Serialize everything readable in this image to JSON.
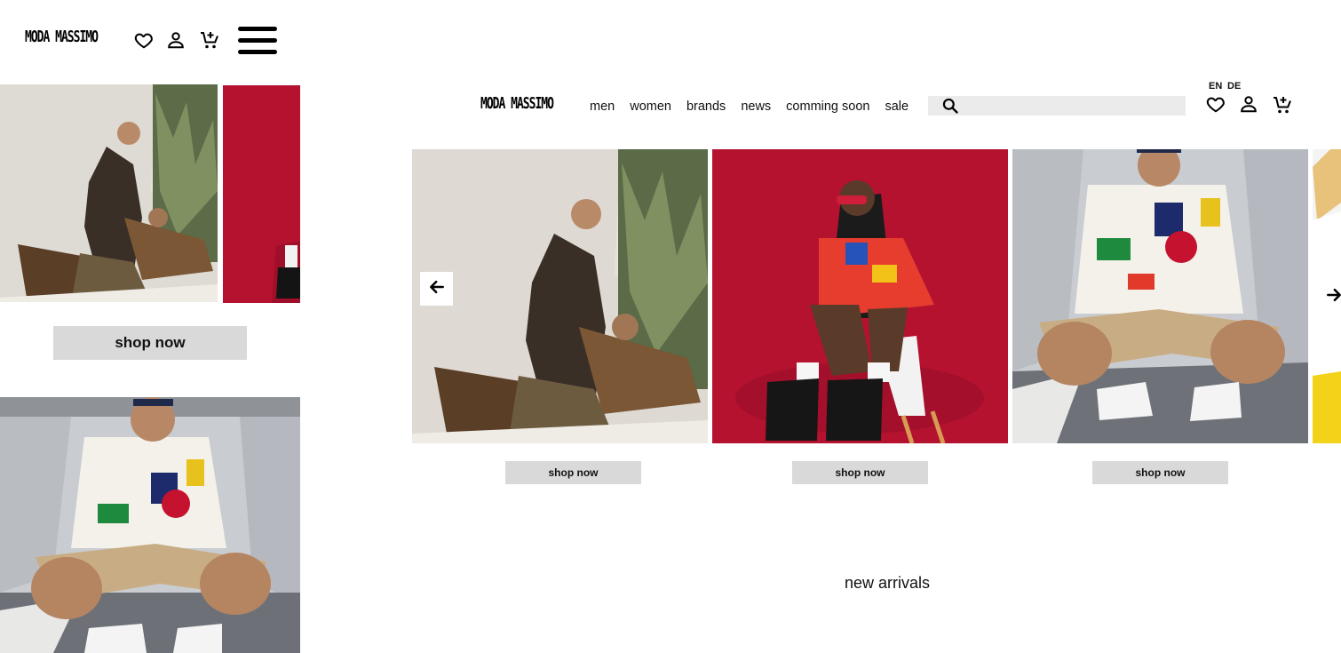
{
  "mobile": {
    "logo_text": "Moda Massimo",
    "shop_now_label": "shop now"
  },
  "desktop": {
    "logo_text": "Moda Massimo",
    "nav": {
      "items": [
        {
          "label": "men"
        },
        {
          "label": "women"
        },
        {
          "label": "brands"
        },
        {
          "label": "news"
        },
        {
          "label": "comming soon"
        },
        {
          "label": "sale"
        }
      ]
    },
    "search": {
      "placeholder": ""
    },
    "languages": [
      "EN",
      "DE"
    ],
    "carousel": {
      "cards": [
        {
          "shop_label": "shop now"
        },
        {
          "shop_label": "shop now"
        },
        {
          "shop_label": "shop now"
        }
      ]
    },
    "section_title": "new arrivals"
  },
  "colors": {
    "button_gray": "#d9d9d9",
    "search_gray": "#ebebeb",
    "accent_red": "#b8102f",
    "text": "#111111"
  },
  "icons": [
    "heart-icon",
    "user-icon",
    "cart-add-icon",
    "hamburger-menu-icon",
    "search-icon",
    "arrow-left-icon",
    "arrow-right-icon"
  ]
}
